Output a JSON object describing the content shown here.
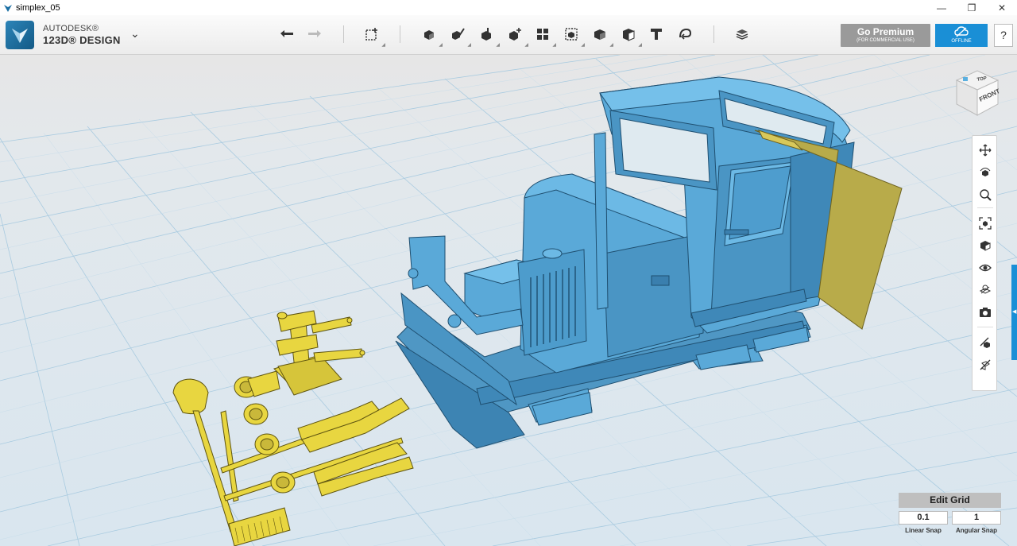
{
  "window": {
    "title": "simplex_05",
    "minimize": "—",
    "restore": "❐",
    "close": "✕"
  },
  "brand": {
    "line1": "AUTODESK®",
    "line2": "123D® DESIGN",
    "menu_chevron": "⌄"
  },
  "toolbar": {
    "icons": [
      "undo-icon",
      "redo-icon",
      "primitives-icon",
      "sketch-icon",
      "construct-icon",
      "modify-icon",
      "pattern-icon",
      "grouping-icon",
      "combine-icon",
      "measure-icon",
      "text-icon",
      "snap-icon",
      "materials-icon"
    ]
  },
  "premium": {
    "label": "Go Premium",
    "sublabel": "(FOR COMMERCIAL USE)"
  },
  "offline": {
    "label": "OFFLINE"
  },
  "help": {
    "label": "?"
  },
  "viewcube": {
    "top": "TOP",
    "front": "FRONT"
  },
  "navbar": {
    "icons": [
      "pan-icon",
      "orbit-icon",
      "zoom-icon",
      "fit-icon",
      "views-icon",
      "visibility-icon",
      "materials-view-icon",
      "screenshot-icon",
      "snap-tool-icon",
      "hide-tool-icon"
    ]
  },
  "grid": {
    "edit_label": "Edit Grid",
    "linear_value": "0.1",
    "angular_value": "1",
    "linear_label": "Linear Snap",
    "angular_label": "Angular Snap"
  },
  "colors": {
    "accent": "#1a8fd6",
    "model_blue": "#5aa9d8",
    "model_yellow": "#e8d640",
    "grid_bg": "#dde8ef"
  }
}
